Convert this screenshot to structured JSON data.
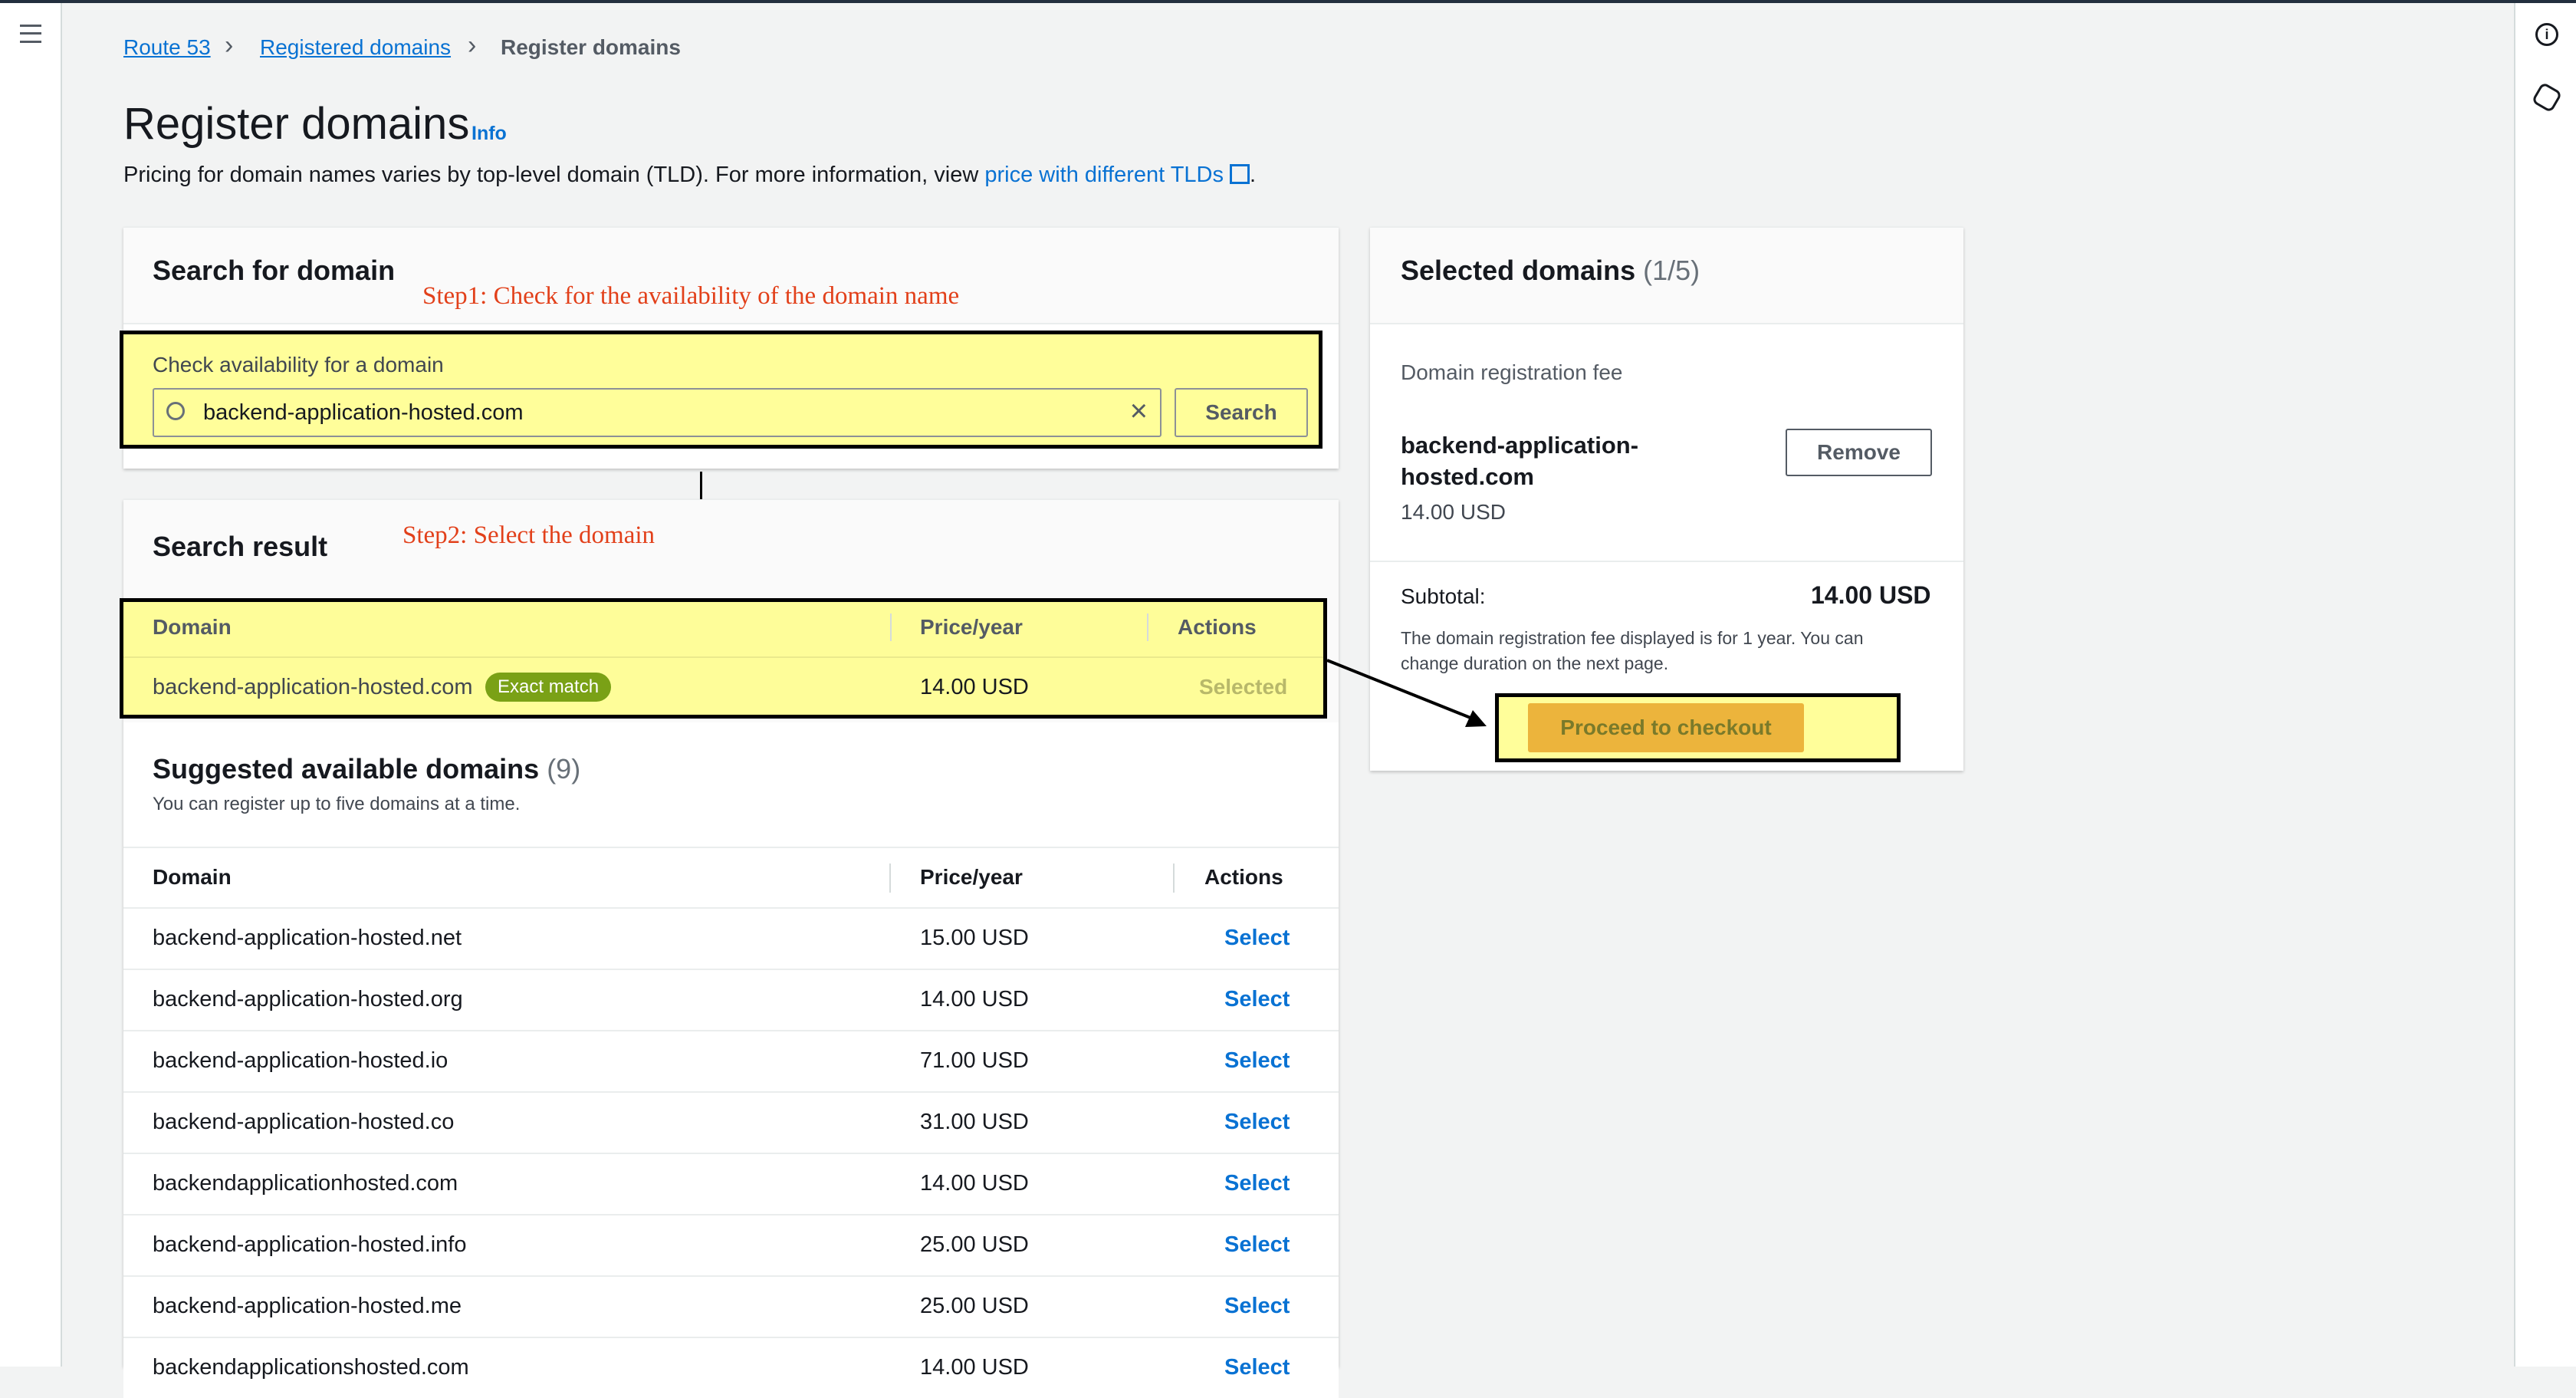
{
  "breadcrumb": [
    "Route 53",
    "Registered domains",
    "Register domains"
  ],
  "page": {
    "title": "Register domains",
    "info": "Info",
    "desc": "Pricing for domain names varies by top-level domain (TLD). For more information, view ",
    "desc_link": "price with different TLDs",
    "desc_end": "."
  },
  "search": {
    "title": "Search for domain",
    "step": "Step1: Check for the availability of the domain name",
    "label": "Check availability for a domain",
    "value": "backend-application-hosted.com",
    "button": "Search"
  },
  "result": {
    "title": "Search result",
    "step": "Step2: Select the domain",
    "headers": [
      "Domain",
      "Price/year",
      "Actions"
    ],
    "domain": "backend-application-hosted.com",
    "badge": "Exact match",
    "price": "14.00 USD",
    "action": "Selected"
  },
  "suggested": {
    "title": "Suggested available domains",
    "count": "(9)",
    "subtitle": "You can register up to five domains at a time.",
    "headers": [
      "Domain",
      "Price/year",
      "Actions"
    ],
    "rows": [
      {
        "domain": "backend-application-hosted.net",
        "price": "15.00 USD",
        "action": "Select"
      },
      {
        "domain": "backend-application-hosted.org",
        "price": "14.00 USD",
        "action": "Select"
      },
      {
        "domain": "backend-application-hosted.io",
        "price": "71.00 USD",
        "action": "Select"
      },
      {
        "domain": "backend-application-hosted.co",
        "price": "31.00 USD",
        "action": "Select"
      },
      {
        "domain": "backendapplicationhosted.com",
        "price": "14.00 USD",
        "action": "Select"
      },
      {
        "domain": "backend-application-hosted.info",
        "price": "25.00 USD",
        "action": "Select"
      },
      {
        "domain": "backend-application-hosted.me",
        "price": "25.00 USD",
        "action": "Select"
      },
      {
        "domain": "backendapplicationshosted.com",
        "price": "14.00 USD",
        "action": "Select"
      }
    ]
  },
  "selected": {
    "title": "Selected domains",
    "count": "(1/5)",
    "fee_label": "Domain registration fee",
    "domain_line1": "backend-application-",
    "domain_line2": "hosted.com",
    "price": "14.00 USD",
    "remove": "Remove",
    "subtotal_label": "Subtotal:",
    "subtotal": "14.00 USD",
    "note": "The domain registration fee displayed is for 1 year. You can change duration on the next page.",
    "checkout": "Proceed to checkout"
  },
  "colors": {
    "link": "#0972d3",
    "checkout": "#ecb43c",
    "highlight": "#fffd78",
    "annotation": "#e2401a",
    "badge": "#7aa116"
  }
}
